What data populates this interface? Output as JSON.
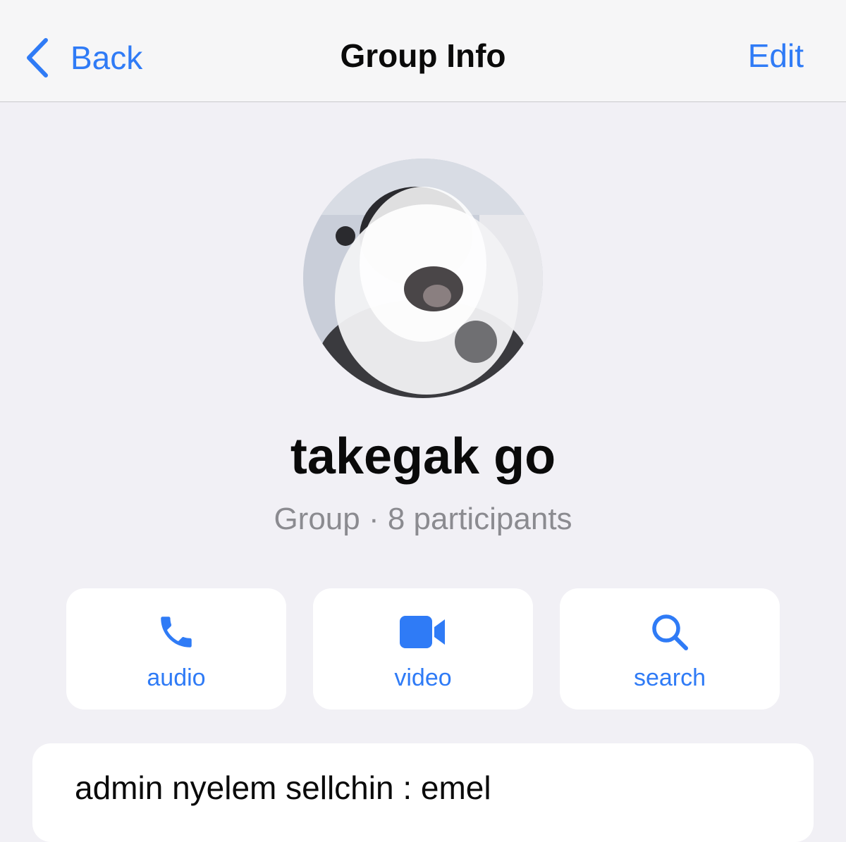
{
  "navbar": {
    "back_label": "Back",
    "title": "Group Info",
    "edit_label": "Edit"
  },
  "group": {
    "name": "takegak go",
    "meta": "Group · 8 participants"
  },
  "actions": [
    {
      "label": "audio",
      "icon": "phone-icon"
    },
    {
      "label": "video",
      "icon": "video-camera-icon"
    },
    {
      "label": "search",
      "icon": "search-icon"
    }
  ],
  "description": {
    "text": "admin nyelem sellchin : emel"
  },
  "colors": {
    "accent": "#2f7bf6",
    "background": "#f1f0f5",
    "navbar": "#f6f6f7",
    "card": "#ffffff",
    "secondary_text": "#8b8b90"
  }
}
